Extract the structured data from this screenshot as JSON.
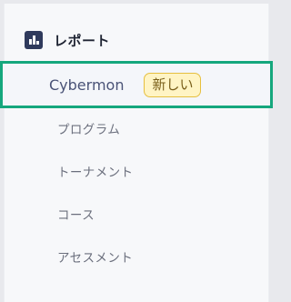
{
  "section": {
    "title": "レポート",
    "icon": "bar-chart-icon"
  },
  "items": [
    {
      "label": "Cybermon",
      "badge": "新しい",
      "active": true
    },
    {
      "label": "プログラム"
    },
    {
      "label": "トーナメント"
    },
    {
      "label": "コース"
    },
    {
      "label": "アセスメント"
    }
  ],
  "colors": {
    "active_border": "#15a77d",
    "badge_bg": "#fff4c4",
    "badge_border": "#e6bf3f",
    "icon_bg": "#2f3a5c"
  }
}
